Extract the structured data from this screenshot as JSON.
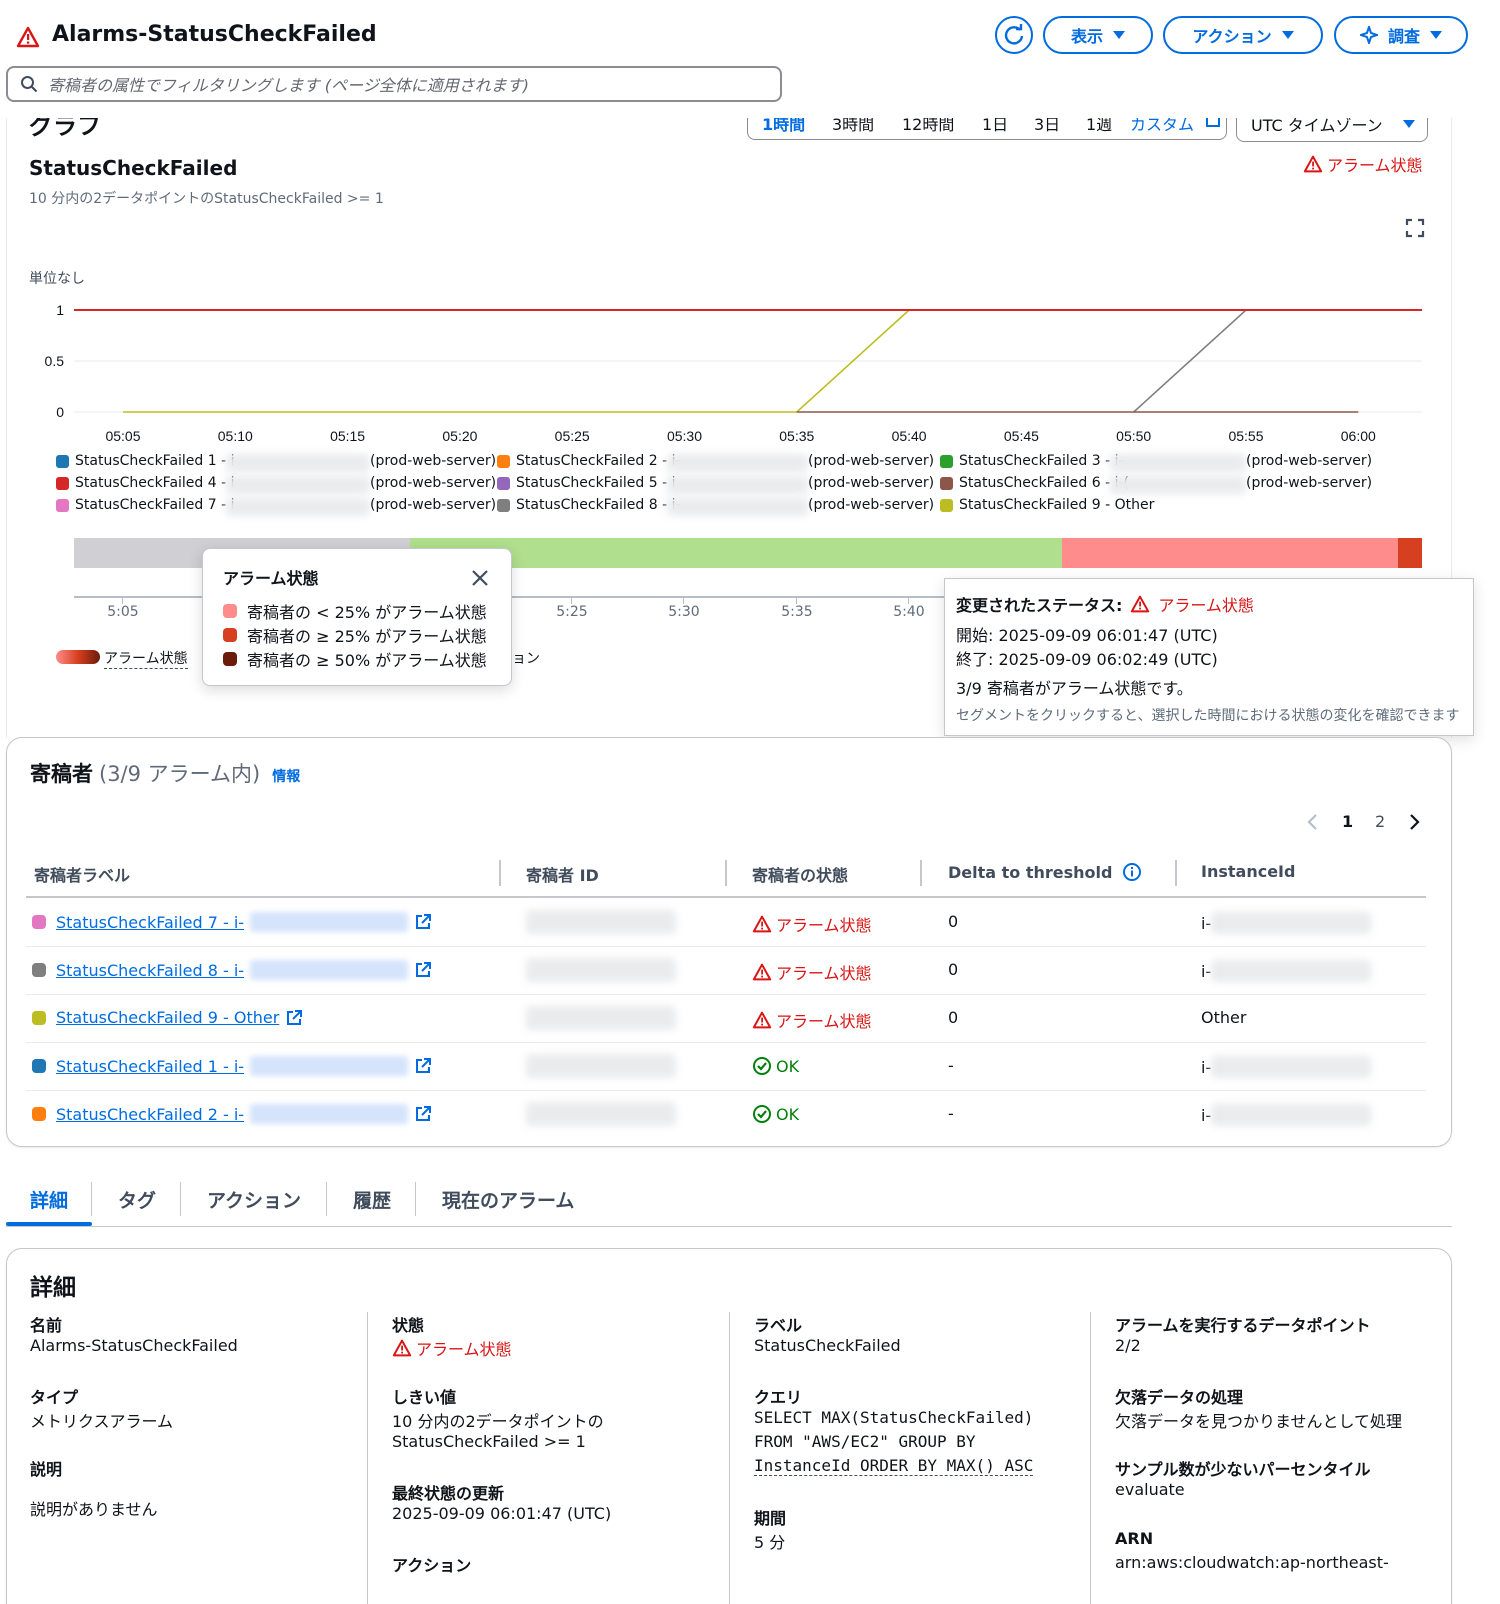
{
  "header": {
    "title": "Alarms-StatusCheckFailed",
    "buttons": {
      "view": "表示",
      "actions": "アクション",
      "investigate": "調査"
    },
    "filter_placeholder": "寄稿者の属性でフィルタリングします (ページ全体に適用されます)"
  },
  "graph": {
    "section_title": "グラフ",
    "time_ranges": [
      "1時間",
      "3時間",
      "12時間",
      "1日",
      "3日",
      "1週",
      "カスタム"
    ],
    "timezone": "UTC タイムゾーン",
    "metric_title": "StatusCheckFailed",
    "metric_subtitle": "10 分内の2データポイントのStatusCheckFailed >= 1",
    "state_badge": "アラーム状態",
    "unit_label": "単位なし"
  },
  "chart_data": {
    "type": "line",
    "ylabel": "単位なし",
    "ylim": [
      0,
      1
    ],
    "y_ticks": [
      "1",
      "0.5",
      "0"
    ],
    "x_ticks": [
      "05:05",
      "05:10",
      "05:15",
      "05:20",
      "05:25",
      "05:30",
      "05:35",
      "05:40",
      "05:45",
      "05:50",
      "05:55",
      "06:00"
    ],
    "threshold": 1,
    "series": [
      {
        "name": "StatusCheckFailed 9 - Other",
        "color": "#bdbd22",
        "x": [
          "05:05",
          "05:35",
          "05:40",
          "06:00"
        ],
        "values": [
          0,
          0,
          1,
          1
        ]
      },
      {
        "name": "StatusCheckFailed 8",
        "color": "#7f7f7f",
        "x": [
          "05:50",
          "05:55",
          "06:00"
        ],
        "values": [
          0,
          1,
          1
        ]
      },
      {
        "name": "StatusCheckFailed 7",
        "color": "#8c564b",
        "x": [
          "05:35",
          "06:00"
        ],
        "values": [
          0,
          0
        ]
      }
    ],
    "legend": [
      {
        "label": "StatusCheckFailed 1 - i",
        "suffix": "(prod-web-server)",
        "color": "#1f77b4"
      },
      {
        "label": "StatusCheckFailed 2 - i-",
        "suffix": "(prod-web-server)",
        "color": "#ff7f0e"
      },
      {
        "label": "StatusCheckFailed 3 - i-",
        "suffix": "(prod-web-server)",
        "color": "#2ca02c"
      },
      {
        "label": "StatusCheckFailed 4 - i",
        "suffix": "(prod-web-server)",
        "color": "#d62728"
      },
      {
        "label": "StatusCheckFailed 5 - i",
        "suffix": "(prod-web-server)",
        "color": "#9467bd"
      },
      {
        "label": "StatusCheckFailed 6 - i-(",
        "suffix": "(prod-web-server)",
        "color": "#8c564b"
      },
      {
        "label": "StatusCheckFailed 7 - i",
        "suffix": "(prod-web-server)",
        "color": "#e377c2"
      },
      {
        "label": "StatusCheckFailed 8 - i-",
        "suffix": "(prod-web-server)",
        "color": "#7f7f7f"
      },
      {
        "label": "StatusCheckFailed 9 - Other",
        "suffix": "",
        "color": "#bcbd22"
      }
    ]
  },
  "timeline": {
    "ticks": [
      "5:05",
      "5:25",
      "5:30",
      "5:35",
      "5:40"
    ],
    "legend_label": "アラーム状態",
    "legend_suffix": "ョン"
  },
  "legend_popover": {
    "title": "アラーム状態",
    "items": [
      "寄稿者の < 25% がアラーム状態",
      "寄稿者の ≥ 25% がアラーム状態",
      "寄稿者の ≥ 50% がアラーム状態"
    ],
    "colors": [
      "#ff8c8c",
      "#d63f1f",
      "#6b1b0a"
    ]
  },
  "status_popover": {
    "changed_label": "変更されたステータス:",
    "state": "アラーム状態",
    "start": "開始:  2025-09-09 06:01:47 (UTC)",
    "end": "終了:  2025-09-09 06:02:49 (UTC)",
    "summary": "3/9 寄稿者がアラーム状態です。",
    "hint": "セグメントをクリックすると、選択した時間における状態の変化を確認できます"
  },
  "contributors": {
    "title": "寄稿者",
    "count": "(3/9 アラーム内)",
    "info": "情報",
    "pages": [
      "1",
      "2"
    ],
    "columns": [
      "寄稿者ラベル",
      "寄稿者 ID",
      "寄稿者の状態",
      "Delta to threshold",
      "InstanceId"
    ],
    "rows": [
      {
        "label": "StatusCheckFailed 7 - i-",
        "color": "#e377c2",
        "state": "アラーム状態",
        "state_type": "alarm",
        "delta": "0",
        "instance": "i-"
      },
      {
        "label": "StatusCheckFailed 8 - i-",
        "color": "#7f7f7f",
        "state": "アラーム状態",
        "state_type": "alarm",
        "delta": "0",
        "instance": "i-"
      },
      {
        "label": "StatusCheckFailed 9 - Other",
        "color": "#bcbd22",
        "state": "アラーム状態",
        "state_type": "alarm",
        "delta": "0",
        "instance": "Other"
      },
      {
        "label": "StatusCheckFailed 1 - i-",
        "color": "#1f77b4",
        "state": "OK",
        "state_type": "ok",
        "delta": "-",
        "instance": "i-"
      },
      {
        "label": "StatusCheckFailed 2 - i-",
        "color": "#ff7f0e",
        "state": "OK",
        "state_type": "ok",
        "delta": "-",
        "instance": "i-"
      }
    ]
  },
  "tabs": [
    "詳細",
    "タグ",
    "アクション",
    "履歴",
    "現在のアラーム"
  ],
  "details": {
    "title": "詳細",
    "name_k": "名前",
    "name_v": "Alarms-StatusCheckFailed",
    "type_k": "タイプ",
    "type_v": "メトリクスアラーム",
    "desc_k": "説明",
    "desc_v": "説明がありません",
    "state_k": "状態",
    "state_v": "アラーム状態",
    "threshold_k": "しきい値",
    "threshold_v1": "10 分内の2データポイントの",
    "threshold_v2": "StatusCheckFailed >= 1",
    "updated_k": "最終状態の更新",
    "updated_v": "2025-09-09 06:01:47 (UTC)",
    "actions_k": "アクション",
    "label_k": "ラベル",
    "label_v": "StatusCheckFailed",
    "query_k": "クエリ",
    "query_v1": "SELECT MAX(StatusCheckFailed)",
    "query_v2": "FROM \"AWS/EC2\" GROUP BY",
    "query_v3": "InstanceId ORDER BY MAX() ASC",
    "period_k": "期間",
    "period_v": "5 分",
    "dp_k": "アラームを実行するデータポイント",
    "dp_v": "2/2",
    "missing_k": "欠落データの処理",
    "missing_v": "欠落データを見つかりませんとして処理",
    "pct_k": "サンプル数が少ないパーセンタイル",
    "pct_v": "evaluate",
    "arn_k": "ARN",
    "arn_v": "arn:aws:cloudwatch:ap-northeast-"
  }
}
